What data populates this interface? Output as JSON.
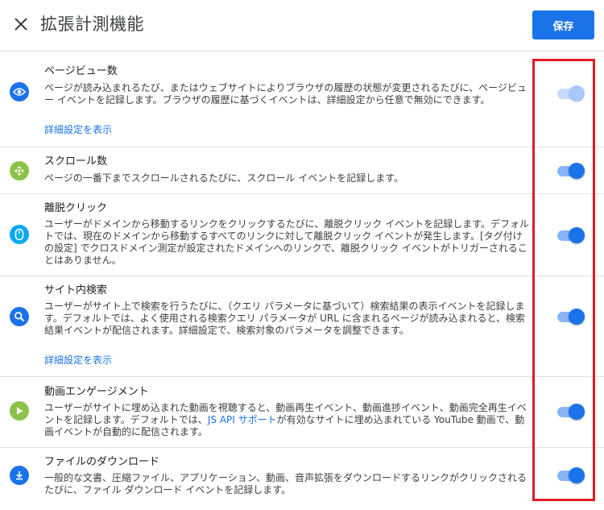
{
  "header": {
    "title": "拡張計測機能",
    "save_label": "保存"
  },
  "colors": {
    "accent": "#1a73e8",
    "highlight_border": "#e31b23"
  },
  "rows": [
    {
      "icon": "eye-icon",
      "title": "ページビュー数",
      "description": "ページが読み込まれるたび、またはウェブサイトによりブラウザの履歴の状態が変更されるたびに、ページビュー イベントを記録します。ブラウザの履歴に基づくイベントは、詳細設定から任意で無効にできます。",
      "link": "詳細設定を表示",
      "toggle_on": true,
      "toggle_disabled": true
    },
    {
      "icon": "scroll-icon",
      "title": "スクロール数",
      "description": "ページの一番下までスクロールされるたびに、スクロール イベントを記録します。",
      "toggle_on": true,
      "toggle_disabled": false
    },
    {
      "icon": "mouse-icon",
      "title": "離脱クリック",
      "description": "ユーザーがドメインから移動するリンクをクリックするたびに、離脱クリック イベントを記録します。デフォルトでは、現在のドメインから移動するすべてのリンクに対して離脱クリック イベントが発生します。[タグ付けの設定] でクロスドメイン測定が設定されたドメインへのリンクで、離脱クリック イベントがトリガーされることはありません。",
      "toggle_on": true,
      "toggle_disabled": false
    },
    {
      "icon": "search-icon",
      "title": "サイト内検索",
      "description": "ユーザーがサイト上で検索を行うたびに、（クエリ パラメータに基づいて）検索結果の表示イベントを記録します。デフォルトでは、よく使用される検索クエリ パラメータが URL に含まれるページが読み込まれると、検索結果イベントが配信されます。詳細設定で、検索対象のパラメータを調整できます。",
      "link": "詳細設定を表示",
      "toggle_on": true,
      "toggle_disabled": false
    },
    {
      "icon": "play-icon",
      "title": "動画エンゲージメント",
      "description_before": "ユーザーがサイトに埋め込まれた動画を視聴すると、動画再生イベント、動画進捗イベント、動画完全再生イベントを記録します。デフォルトでは、",
      "description_link": "JS API サポート",
      "description_after": "が有効なサイトに埋め込まれている YouTube 動画で、動画イベントが自動的に配信されます。",
      "toggle_on": true,
      "toggle_disabled": false
    },
    {
      "icon": "download-icon",
      "title": "ファイルのダウンロード",
      "description": "一般的な文書、圧縮ファイル、アプリケーション、動画、音声拡張をダウンロードするリンクがクリックされるたびに、ファイル ダウンロード イベントを記録します。",
      "toggle_on": true,
      "toggle_disabled": false
    }
  ]
}
